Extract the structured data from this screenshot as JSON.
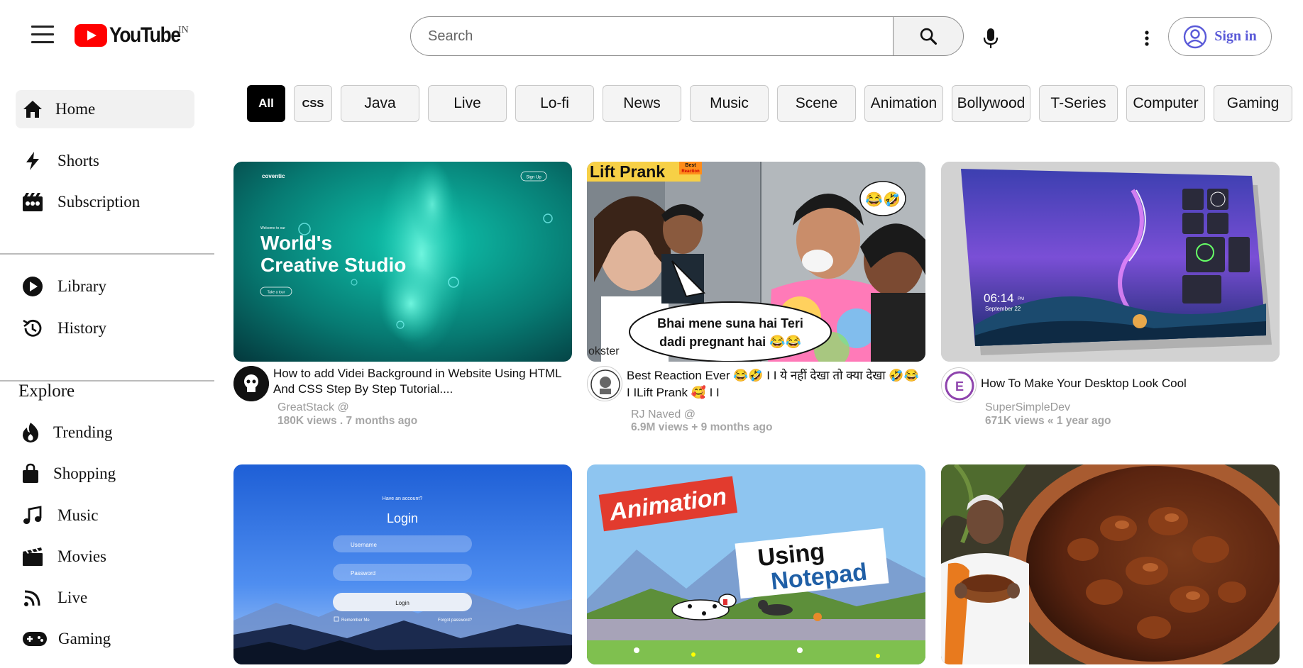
{
  "header": {
    "logo_text": "YouTube",
    "country_code": "IN",
    "search_placeholder": "Search",
    "signin_label": "Sign in"
  },
  "sidebar": {
    "main": [
      {
        "label": "Home",
        "icon": "home-icon"
      },
      {
        "label": "Shorts",
        "icon": "shorts-icon"
      },
      {
        "label": "Subscription",
        "icon": "subscription-icon"
      }
    ],
    "library": [
      {
        "label": "Library",
        "icon": "library-icon"
      },
      {
        "label": "History",
        "icon": "history-icon"
      }
    ],
    "explore_title": "Explore",
    "explore": [
      {
        "label": "Trending",
        "icon": "trending-icon"
      },
      {
        "label": "Shopping",
        "icon": "shopping-icon"
      },
      {
        "label": "Music",
        "icon": "music-icon"
      },
      {
        "label": "Movies",
        "icon": "movies-icon"
      },
      {
        "label": "Live",
        "icon": "live-icon"
      },
      {
        "label": "Gaming",
        "icon": "gaming-icon"
      }
    ]
  },
  "chips": [
    "All",
    "CSS",
    "Java",
    "Live",
    "Lo-fi",
    "News",
    "Music",
    "Scene",
    "Animation",
    "Bollywood",
    "T-Series",
    "Computer",
    "Gaming"
  ],
  "videos": [
    {
      "title": "How to add Videi Background in Website Using HTML And CSS Step By Step Tutorial....",
      "channel": "GreatStack @",
      "meta": "180K views . 7 months ago",
      "thumb_brand": "coventic",
      "thumb_button": "Sign Up",
      "thumb_welcome": "Welcome to our",
      "thumb_heading_1": "World's",
      "thumb_heading_2": "Creative Studio",
      "thumb_cta": "Take a tour"
    },
    {
      "title": "Best Reaction Ever 😂🤣 I I ये नहीं देखा तो क्या देखा 🤣😂 I ILift Prank 🥰 I I",
      "channel": "RJ Naved @",
      "meta": "6.9M views + 9 months ago",
      "thumb_title": "Lift Prank",
      "thumb_badge_1": "Best",
      "thumb_badge_2": "Reaction",
      "thumb_bubble_1": "Bhai mene suna hai Teri",
      "thumb_bubble_2": "dadi pregnant hai 😂😂",
      "thumb_emoji": "😂🤣",
      "thumb_watermark": "okster"
    },
    {
      "title": "How To Make Your Desktop Look Cool",
      "channel": "SuperSimpleDev",
      "meta": "671K views « 1 year ago",
      "thumb_time": "06:14",
      "thumb_ampm": "PM",
      "thumb_date": "September 22"
    },
    {
      "thumb_prompt": "Have an account?",
      "thumb_heading": "Login",
      "thumb_user": "Username",
      "thumb_pass": "Password",
      "thumb_button": "Login",
      "thumb_remember": "Remember Me",
      "thumb_forgot": "Forgot password?"
    },
    {
      "thumb_word_1": "Animation",
      "thumb_word_2": "Using",
      "thumb_word_3": "Notepad"
    },
    {}
  ],
  "colors": {
    "brand_red": "#ff0000",
    "signin_blue": "#5a5ad8",
    "chip_active_bg": "#000000",
    "chip_bg": "#f4f4f4"
  }
}
